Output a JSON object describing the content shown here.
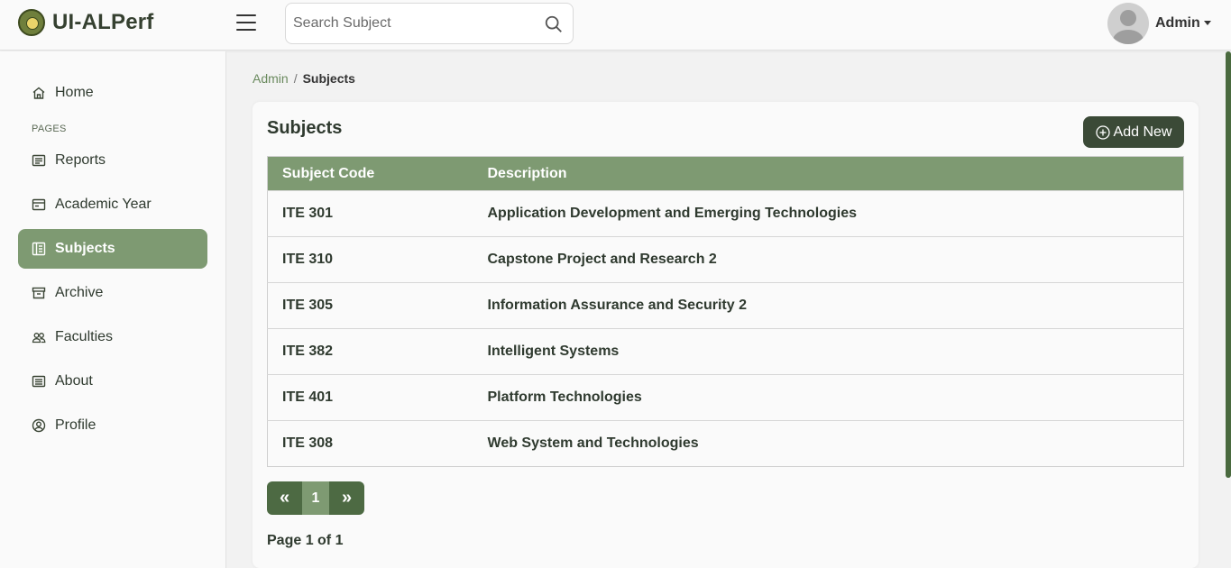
{
  "app": {
    "title": "UI-ALPerf"
  },
  "search": {
    "placeholder": "Search Subject"
  },
  "user": {
    "name": "Admin"
  },
  "sidebar": {
    "section_label": "PAGES",
    "items": [
      {
        "label": "Home",
        "icon": "home-icon"
      },
      {
        "label": "Reports",
        "icon": "reports-icon"
      },
      {
        "label": "Academic Year",
        "icon": "calendar-card-icon"
      },
      {
        "label": "Subjects",
        "icon": "subjects-icon",
        "active": true
      },
      {
        "label": "Archive",
        "icon": "archive-icon"
      },
      {
        "label": "Faculties",
        "icon": "people-icon"
      },
      {
        "label": "About",
        "icon": "about-icon"
      },
      {
        "label": "Profile",
        "icon": "profile-icon"
      }
    ]
  },
  "breadcrumb": {
    "root": "Admin",
    "separator": "/",
    "current": "Subjects"
  },
  "card": {
    "title": "Subjects",
    "add_label": "Add New"
  },
  "table": {
    "headers": [
      "Subject Code",
      "Description"
    ],
    "rows": [
      [
        "ITE 301",
        "Application Development and Emerging Technologies"
      ],
      [
        "ITE 310",
        "Capstone Project and Research 2"
      ],
      [
        "ITE 305",
        "Information Assurance and Security 2"
      ],
      [
        "ITE 382",
        "Intelligent Systems"
      ],
      [
        "ITE 401",
        "Platform Technologies"
      ],
      [
        "ITE 308",
        "Web System and Technologies"
      ]
    ]
  },
  "pagination": {
    "prev": "«",
    "current": "1",
    "next": "»",
    "info": "Page 1 of 1"
  },
  "colors": {
    "accent": "#7e9a72",
    "dark": "#3b4a37",
    "pager_nav": "#4d6a43"
  }
}
